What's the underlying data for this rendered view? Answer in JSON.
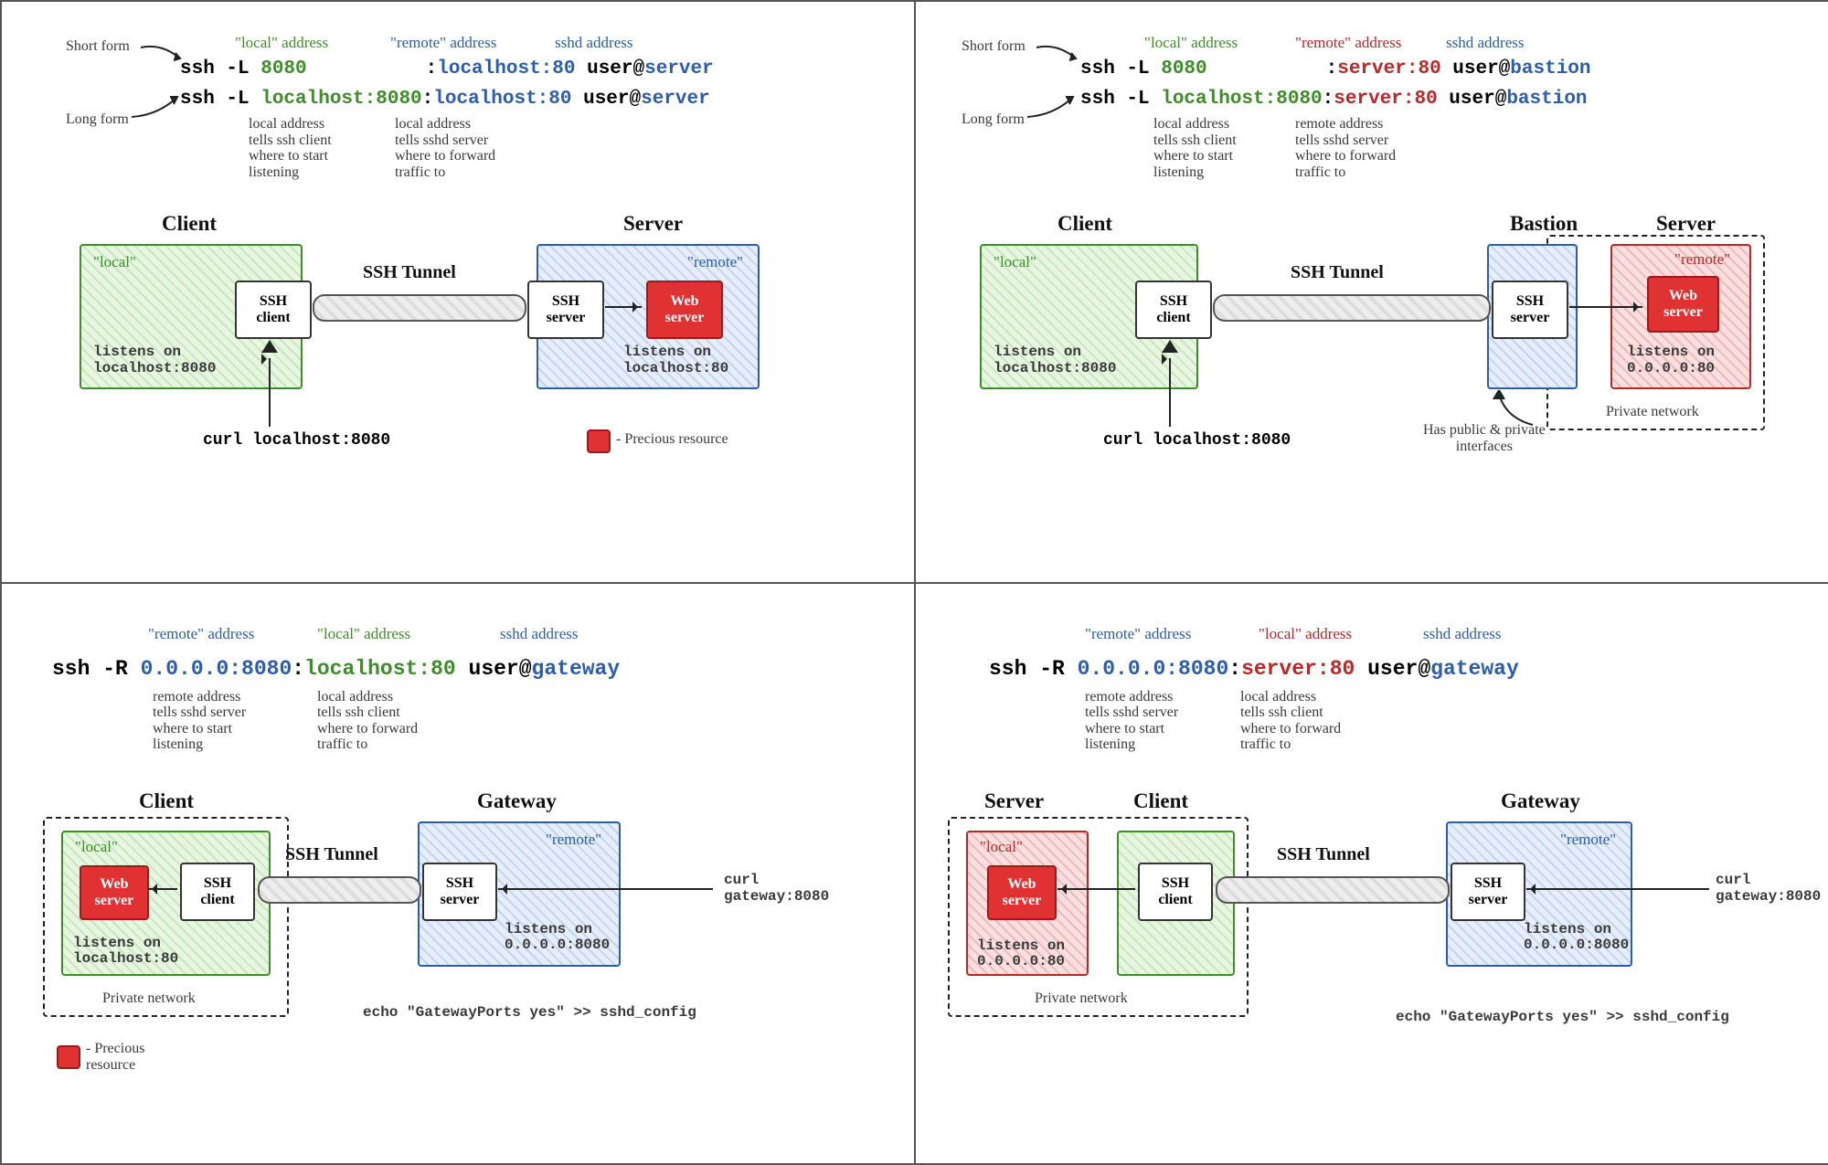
{
  "legend": {
    "precious": "- Precious resource"
  },
  "common": {
    "ssh_client": "SSH\nclient",
    "ssh_server": "SSH\nserver",
    "web_server": "Web\nserver",
    "tunnel": "SSH Tunnel",
    "local_tag": "\"local\"",
    "remote_tag": "\"remote\"",
    "private_net": "Private network"
  },
  "q1": {
    "short_form": "Short form",
    "long_form": "Long form",
    "hdr_local": "\"local\" address",
    "hdr_remote": "\"remote\" address",
    "hdr_sshd": "sshd address",
    "cmd1": {
      "ssh": "ssh -L ",
      "local": "8080",
      "colon": ":",
      "remote": "localhost:80",
      "user": " user@",
      "host": "server"
    },
    "cmd2": {
      "ssh": "ssh -L ",
      "local": "localhost:8080",
      "colon": ":",
      "remote": "localhost:80",
      "user": " user@",
      "host": "server"
    },
    "note_local": "local address\ntells ssh client\nwhere to start\nlistening",
    "note_remote": "local address\ntells sshd server\nwhere to forward\ntraffic to",
    "client_title": "Client",
    "server_title": "Server",
    "listens_client": "listens on\nlocalhost:8080",
    "listens_server": "listens on\nlocalhost:80",
    "curl": "curl localhost:8080"
  },
  "q2": {
    "short_form": "Short form",
    "long_form": "Long form",
    "hdr_local": "\"local\" address",
    "hdr_remote": "\"remote\" address",
    "hdr_sshd": "sshd address",
    "cmd1": {
      "ssh": "ssh -L ",
      "local": "8080",
      "colon": ":",
      "remote": "server:80",
      "user": " user@",
      "host": "bastion"
    },
    "cmd2": {
      "ssh": "ssh -L ",
      "local": "localhost:8080",
      "colon": ":",
      "remote": "server:80",
      "user": " user@",
      "host": "bastion"
    },
    "note_local": "local address\ntells ssh client\nwhere to start\nlistening",
    "note_remote": "remote address\ntells sshd server\nwhere to forward\ntraffic to",
    "client_title": "Client",
    "bastion_title": "Bastion",
    "server_title": "Server",
    "listens_client": "listens on\nlocalhost:8080",
    "listens_server": "listens on\n0.0.0.0:80",
    "bastion_note": "Has public & private\ninterfaces",
    "curl": "curl localhost:8080"
  },
  "q3": {
    "hdr_remote": "\"remote\" address",
    "hdr_local": "\"local\" address",
    "hdr_sshd": "sshd address",
    "cmd": {
      "ssh": "ssh -R ",
      "remote": "0.0.0.0:8080",
      "colon": ":",
      "local": "localhost:80",
      "user": " user@",
      "host": "gateway"
    },
    "note_remote": "remote address\ntells sshd server\nwhere to start\nlistening",
    "note_local": "local address\ntells ssh client\nwhere to forward\ntraffic to",
    "client_title": "Client",
    "gateway_title": "Gateway",
    "listens_client": "listens on\nlocalhost:80",
    "listens_gw": "listens on\n0.0.0.0:8080",
    "curl": "curl\ngateway:8080",
    "gw_config": "echo \"GatewayPorts yes\" >> sshd_config"
  },
  "q4": {
    "hdr_remote": "\"remote\" address",
    "hdr_local": "\"local\" address",
    "hdr_sshd": "sshd address",
    "cmd": {
      "ssh": "ssh -R ",
      "remote": "0.0.0.0:8080",
      "colon": ":",
      "local": "server:80",
      "user": " user@",
      "host": "gateway"
    },
    "note_remote": "remote address\ntells sshd server\nwhere to start\nlistening",
    "note_local": "local address\ntells ssh client\nwhere to forward\ntraffic to",
    "server_title": "Server",
    "client_title": "Client",
    "gateway_title": "Gateway",
    "listens_server": "listens on\n0.0.0.0:80",
    "listens_gw": "listens on\n0.0.0.0:8080",
    "curl": "curl\ngateway:8080",
    "gw_config": "echo \"GatewayPorts yes\" >> sshd_config"
  }
}
